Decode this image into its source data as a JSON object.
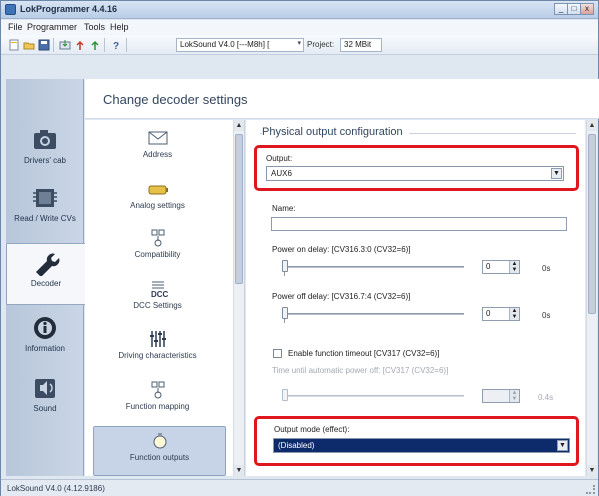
{
  "window": {
    "title": "LokProgrammer 4.4.16",
    "controls": {
      "minimize": "_",
      "maximize": "□",
      "close": "x"
    }
  },
  "menu": {
    "items": [
      "File",
      "Programmer",
      "Tools",
      "Help"
    ]
  },
  "toolbar": {
    "decoder_combo": "LokSound V4.0 [---M8h] [",
    "project_label": "Project:",
    "project_value": "32 MBit",
    "icons": [
      "new-icon",
      "open-icon",
      "save-icon",
      "read-icon",
      "write-icon",
      "decoder-icon",
      "help-icon"
    ]
  },
  "nav": {
    "items": [
      {
        "label": "Drivers' cab",
        "icon": "camera-icon"
      },
      {
        "label": "Read / Write CVs",
        "icon": "chip-icon"
      },
      {
        "label": "Decoder",
        "icon": "wrench-icon",
        "active": true
      },
      {
        "label": "Information",
        "icon": "info-icon"
      },
      {
        "label": "Sound",
        "icon": "speaker-icon"
      }
    ]
  },
  "content": {
    "header_title": "Change decoder settings"
  },
  "categories": [
    {
      "label": "Address",
      "icon": "envelope-icon"
    },
    {
      "label": "Analog settings",
      "icon": "battery-icon"
    },
    {
      "label": "Compatibility",
      "icon": "switch-icon"
    },
    {
      "label": "DCC Settings",
      "icon": "dcc-icon"
    },
    {
      "label": "Driving characteristics",
      "icon": "slider-icon"
    },
    {
      "label": "Function mapping",
      "icon": "mapping-icon"
    },
    {
      "label": "Function outputs",
      "icon": "bulb-icon",
      "selected": true
    }
  ],
  "config": {
    "section_title": "Physical output configuration",
    "output_label": "Output:",
    "output_value": "AUX6",
    "name_label": "Name:",
    "name_value": "",
    "power_on_label": "Power on delay: [CV316.3:0 (CV32=6)]",
    "power_on_value": "0",
    "power_on_unit": "0s",
    "power_off_label": "Power off delay: [CV316.7:4 (CV32=6)]",
    "power_off_value": "0",
    "power_off_unit": "0s",
    "timeout_label": "Enable function timeout [CV317 (CV32=6)]",
    "timeout_checked": false,
    "auto_off_label": "Time until automatic power off: [CV317 (CV32=6)]",
    "auto_off_value": "",
    "auto_off_unit": "0.4s",
    "mode_label": "Output mode (effect):",
    "mode_value": "(Disabled)"
  },
  "status": {
    "text": "LokSound V4.0 (4.12.9186)"
  },
  "colors": {
    "highlight": "#e0161f",
    "selection": "#0d2b6b"
  }
}
